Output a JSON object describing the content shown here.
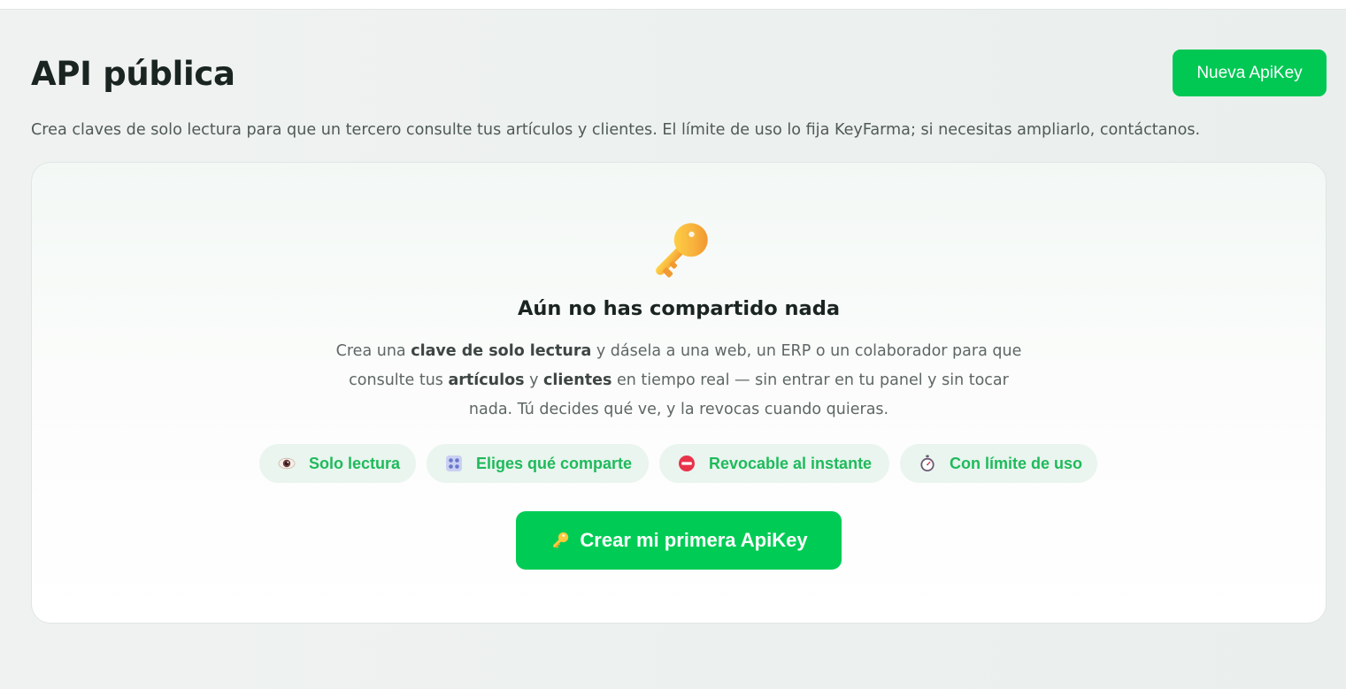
{
  "header": {
    "title": "API pública",
    "new_button_label": "Nueva ApiKey"
  },
  "subtitle": "Crea claves de solo lectura para que un tercero consulte tus artículos y clientes. El límite de uso lo fija KeyFarma; si necesitas ampliarlo, contáctanos.",
  "empty_state": {
    "icon": "key-icon",
    "title": "Aún no has compartido nada",
    "description": {
      "t1": "Crea una ",
      "b1": "clave de solo lectura",
      "t2": " y dásela a una web, un ERP o un colaborador para que consulte tus ",
      "b2": "artículos",
      "t3": " y ",
      "b3": "clientes",
      "t4": " en tiempo real — sin entrar en tu panel y sin tocar nada. Tú decides qué ve, y la revocas cuando quieras."
    },
    "features": [
      {
        "icon": "eye-icon",
        "label": "Solo lectura"
      },
      {
        "icon": "grid-icon",
        "label": "Eliges qué comparte"
      },
      {
        "icon": "no-entry-icon",
        "label": "Revocable al instante"
      },
      {
        "icon": "stopwatch-icon",
        "label": "Con límite de uso"
      }
    ],
    "cta_icon": "key-icon",
    "cta_label": "Crear mi primera ApiKey"
  },
  "colors": {
    "accent": "#00c853",
    "chip_bg": "#e9f5ee",
    "chip_text": "#1fba5c",
    "heading": "#1a2421",
    "body_text": "#5e6765"
  }
}
